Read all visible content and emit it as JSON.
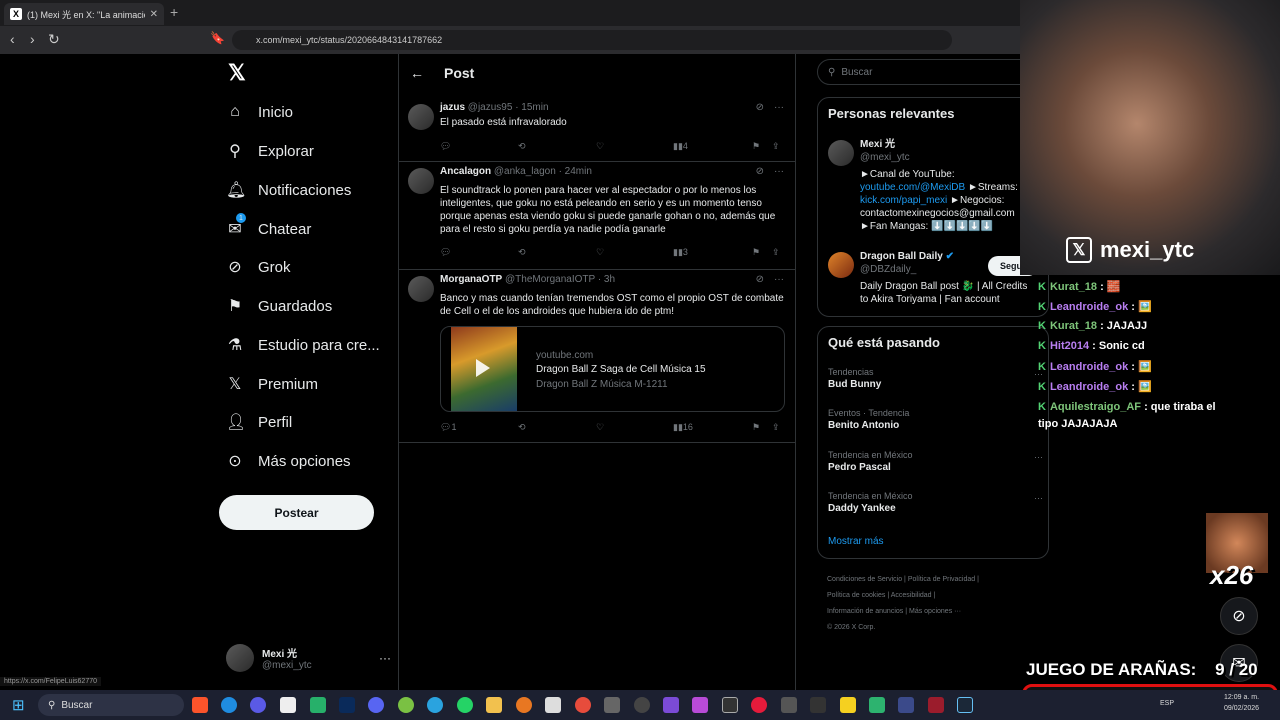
{
  "browser": {
    "tab_title": "(1) Mexi 光 en X: \"La animación d",
    "url": "x.com/mexi_ytc/status/2020664843141787662",
    "status_url": "https://x.com/FelipeLuis62770"
  },
  "nav": {
    "items": [
      {
        "label": "Inicio",
        "icon": "home-icon"
      },
      {
        "label": "Explorar",
        "icon": "search-icon"
      },
      {
        "label": "Notificaciones",
        "icon": "bell-icon"
      },
      {
        "label": "Chatear",
        "icon": "mail-icon"
      },
      {
        "label": "Grok",
        "icon": "grok-icon"
      },
      {
        "label": "Guardados",
        "icon": "bookmark-icon"
      },
      {
        "label": "Estudio para cre...",
        "icon": "flask-icon"
      },
      {
        "label": "Premium",
        "icon": "x-logo-icon"
      },
      {
        "label": "Perfil",
        "icon": "person-icon"
      },
      {
        "label": "Más opciones",
        "icon": "more-circle-icon"
      }
    ],
    "chat_badge": "1",
    "post_button": "Postear",
    "profile": {
      "name": "Mexi 光",
      "handle": "@mexi_ytc"
    }
  },
  "main": {
    "title": "Post",
    "tweets": [
      {
        "name": "jazus",
        "handle": "@jazus95",
        "time": "· 15min",
        "text": "El pasado está infravalorado",
        "views": "4"
      },
      {
        "name": "Ancalagon",
        "handle": "@anka_lagon",
        "time": "· 24min",
        "text": "El soundtrack lo ponen para hacer ver al espectador o por lo menos los inteligentes, que goku no está peleando en serio y es un momento tenso porque apenas esta viendo goku si puede ganarle gohan o no, además que para el resto si goku perdía ya nadie podía ganarle",
        "views": "3"
      },
      {
        "name": "MorganaOTP",
        "handle": "@TheMorganaIOTP",
        "time": "· 3h",
        "text": "Banco y mas cuando tenían tremendos OST como el propio OST de combate de Cell o el de los androides que hubiera ido de ptm!",
        "replies": "1",
        "views": "16",
        "card": {
          "domain": "youtube.com",
          "title": "Dragon Ball Z Saga de Cell Música 15",
          "desc": "Dragon Ball Z Música M-1211"
        }
      }
    ]
  },
  "right": {
    "search_placeholder": "Buscar",
    "relevant": {
      "title": "Personas relevantes",
      "people": [
        {
          "name": "Mexi 光",
          "handle": "@mexi_ytc",
          "bio1": "►Canal de YouTube:",
          "link1": "youtube.com/@MexiDB",
          "bio2": " ►Streams:",
          "link2": "kick.com/papi_mexi",
          "bio3": " ►Negocios:",
          "bio4": "contactomexinegocios@gmail.com",
          "bio5": "►Fan Mangas: ⬇️⬇️⬇️⬇️⬇️"
        },
        {
          "name": "Dragon Ball Daily",
          "handle": "@DBZdaily_",
          "bio1": "Daily Dragon Ball post 🐉 | All Credits",
          "bio2": "to Akira Toriyama | Fan account",
          "follow": "Segu"
        }
      ]
    },
    "trends": {
      "title": "Qué está pasando",
      "items": [
        {
          "cat": "Tendencias",
          "name": "Bud Bunny"
        },
        {
          "cat": "Eventos · Tendencia",
          "name": "Benito Antonio"
        },
        {
          "cat": "Tendencia en México",
          "name": "Pedro Pascal"
        },
        {
          "cat": "Tendencia en México",
          "name": "Daddy Yankee"
        }
      ],
      "more": "Mostrar más"
    },
    "footer": {
      "l1a": "Condiciones de Servicio",
      "l1b": "Política de Privacidad",
      "l2a": "Política de cookies",
      "l2b": "Accesibilidad",
      "l3a": "Información de anuncios",
      "l3b": "Más opciones ···",
      "l4": "© 2026 X Corp."
    }
  },
  "stream": {
    "handle": "mexi_ytc",
    "chat": [
      {
        "user": "Kurat_18",
        "msg": " : 🧱",
        "color": "#7ec57a"
      },
      {
        "user": "Leandroide_ok",
        "msg": " : 🖼️",
        "color": "#b97ff2"
      },
      {
        "user": "Kurat_18",
        "msg": " : JAJAJJ",
        "color": "#7ec57a"
      },
      {
        "user": "Hit2014",
        "msg": " : Sonic cd",
        "color": "#b97ff2"
      },
      {
        "user": "Leandroide_ok",
        "msg": " : 🖼️",
        "color": "#b97ff2"
      },
      {
        "user": "Leandroide_ok",
        "msg": " : 🖼️",
        "color": "#b97ff2"
      },
      {
        "user": "Aquilestraigo_AF",
        "msg": " : que tiraba el",
        "color": "#7ec57a"
      }
    ],
    "chat_cont": "tipo JAJAJAJA",
    "multiplier": "x26",
    "game_label": "JUEGO DE ARAÑAS:",
    "game_score": "9 / 20",
    "progress": 0.45
  },
  "taskbar": {
    "search": "Buscar",
    "time": "12:09 a. m.",
    "date": "09/02/2026",
    "lang": "ESP"
  }
}
